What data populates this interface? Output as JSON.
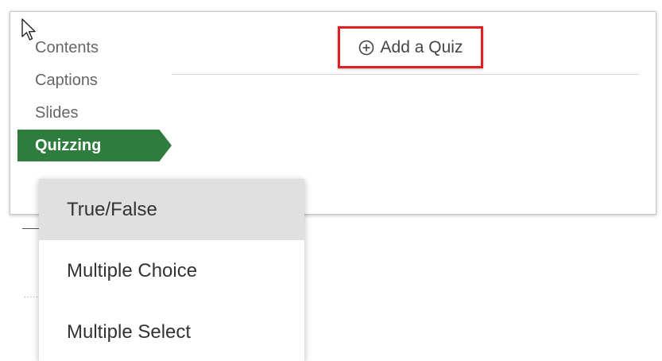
{
  "nav": {
    "items": [
      {
        "label": "Contents",
        "active": false
      },
      {
        "label": "Captions",
        "active": false
      },
      {
        "label": "Slides",
        "active": false
      },
      {
        "label": "Quizzing",
        "active": true
      }
    ]
  },
  "header": {
    "add_quiz_label": "Add a Quiz",
    "add_quiz_icon": "plus-circle-icon",
    "highlight_color": "#e02020"
  },
  "menu": {
    "items": [
      {
        "label": "True/False",
        "highlighted": true
      },
      {
        "label": "Multiple Choice",
        "highlighted": false
      },
      {
        "label": "Multiple Select",
        "highlighted": false
      }
    ]
  },
  "colors": {
    "active_nav": "#2e7d3e",
    "menu_hover": "#e0e0e0"
  },
  "misc": {
    "dots": "......"
  }
}
